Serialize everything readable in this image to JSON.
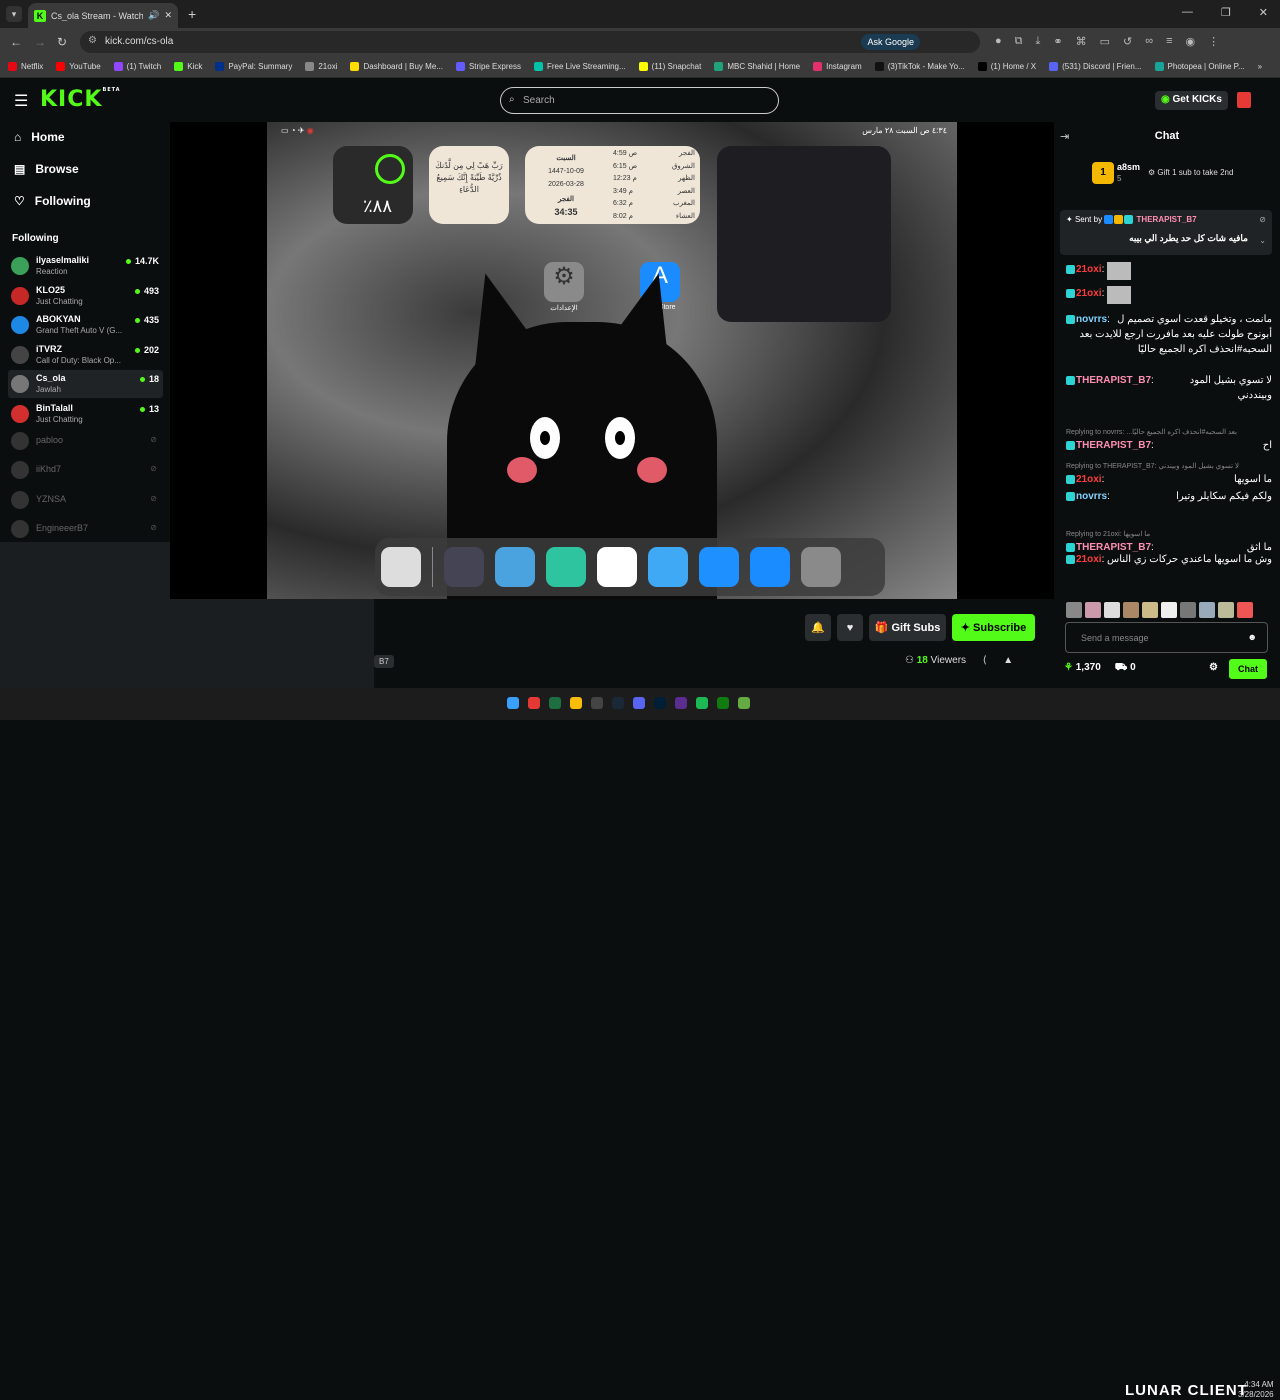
{
  "browser": {
    "tab_title": "Cs_ola Stream - Watch Live",
    "new_tab": "+",
    "url": "kick.com/cs-ola",
    "ask_google": "Ask Google",
    "bookmarks": [
      {
        "label": "Netflix",
        "color": "#e50914"
      },
      {
        "label": "YouTube",
        "color": "#ff0000"
      },
      {
        "label": "(1) Twitch",
        "color": "#9146ff"
      },
      {
        "label": "Kick",
        "color": "#53fc18"
      },
      {
        "label": "PayPal: Summary",
        "color": "#003087"
      },
      {
        "label": "21oxi",
        "color": "#888888"
      },
      {
        "label": "Dashboard | Buy Me...",
        "color": "#ffdd00"
      },
      {
        "label": "Stripe Express",
        "color": "#635bff"
      },
      {
        "label": "Free Live Streaming...",
        "color": "#00c2a8"
      },
      {
        "label": "(11) Snapchat",
        "color": "#fffc00"
      },
      {
        "label": "MBC Shahid | Home",
        "color": "#1fa37a"
      },
      {
        "label": "Instagram",
        "color": "#e1306c"
      },
      {
        "label": "(3)TikTok - Make Yo...",
        "color": "#111111"
      },
      {
        "label": "(1) Home / X",
        "color": "#000000"
      },
      {
        "label": "(531) Discord | Frien...",
        "color": "#5865f2"
      },
      {
        "label": "Photopea | Online P...",
        "color": "#18a497"
      }
    ]
  },
  "kick": {
    "logo": "KICK",
    "logo_beta": "BETA",
    "search_placeholder": "Search",
    "get_kicks": "Get KICKs"
  },
  "sidebar": {
    "nav": [
      {
        "label": "Home",
        "icon": "home-icon"
      },
      {
        "label": "Browse",
        "icon": "browse-icon"
      },
      {
        "label": "Following",
        "icon": "heart-icon"
      }
    ],
    "following_header": "Following",
    "channels": [
      {
        "name": "ilyaselmaliki",
        "game": "Reaction",
        "viewers": "14.7K",
        "color": "#3aa05a"
      },
      {
        "name": "KLO25",
        "game": "Just Chatting",
        "viewers": "493",
        "color": "#c62828"
      },
      {
        "name": "ABOKYAN",
        "game": "Grand Theft Auto V (G...",
        "viewers": "435",
        "color": "#1e88e5"
      },
      {
        "name": "iTVRZ",
        "game": "Call of Duty: Black Op...",
        "viewers": "202",
        "color": "#444444"
      },
      {
        "name": "Cs_ola",
        "game": "Jawlah",
        "viewers": "18",
        "color": "#777777"
      },
      {
        "name": "BinTalall",
        "game": "Just Chatting",
        "viewers": "13",
        "color": "#d32f2f"
      }
    ],
    "offline": [
      "pabloo",
      "iiKhd7",
      "YZNSA",
      "EngineeerB7"
    ]
  },
  "stream": {
    "ipad": {
      "battery_widget": "٪٨٨",
      "dua_text": "رَبِّ هَبْ لِي مِن لَّدُنكَ ذُرِّيَّةً طَيِّبَةً إِنَّكَ سَمِيعُ الدُّعَاءِ",
      "day": "السبت",
      "hijri": "1447-10-09",
      "greg": "2026-03-28",
      "prayer_next": "الفجر",
      "countdown": "34:35",
      "prayers": [
        {
          "name": "الفجر",
          "time": "4:59 ص"
        },
        {
          "name": "الشروق",
          "time": "6:15 ص"
        },
        {
          "name": "الظهر",
          "time": "12:23 م"
        },
        {
          "name": "العصر",
          "time": "3:49 م"
        },
        {
          "name": "المغرب",
          "time": "6:32 م"
        },
        {
          "name": "العشاء",
          "time": "8:02 م"
        }
      ],
      "status_time": "٤:٣٤ ص السبت ٢٨ مارس",
      "settings_label": "الإعدادات",
      "appstore_label": "App Store"
    },
    "gift_subs": "Gift Subs",
    "subscribe": "Subscribe",
    "viewers_count": "18",
    "viewers_label": "Viewers",
    "tag": "B7"
  },
  "chat": {
    "title": "Chat",
    "leader_name": "a8sm",
    "leader_count": "5",
    "leader_rank": "1",
    "gift_prompt": "Gift 1 sub to take 2nd",
    "pinned": {
      "sent_by": "Sent by",
      "user": "THERAPIST_B7",
      "text": "مافيه شات كل حد يطرد الي بيبه"
    },
    "messages": [
      {
        "user": "21oxi",
        "color": "#ff3b3b",
        "text": "",
        "reply": ""
      },
      {
        "user": "21oxi",
        "color": "#ff3b3b",
        "text": "",
        "reply": ""
      },
      {
        "user": "novrrs",
        "color": "#7fd3ff",
        "text": "مانمت ، وتخيلو قعدت اسوي تصميم ل أبونوح طولت عليه بعد مافررت ارجع للايدت بعد السحبه#انحذف اكره الجميع حاليًا",
        "reply": ""
      },
      {
        "user": "THERAPIST_B7",
        "color": "#ff8fb1",
        "text": "لا تسوي بشيل المود وبينددني",
        "reply": ""
      },
      {
        "user": "THERAPIST_B7",
        "color": "#ff8fb1",
        "text": "اح",
        "reply": "Replying to novrrs: ...بعد السحبه#انحذف اكره الجميع حاليًا"
      },
      {
        "user": "21oxi",
        "color": "#ff3b3b",
        "text": "ما اسويها",
        "reply": "Replying to THERAPIST_B7: لا تسوي بشيل المود وبيندني"
      },
      {
        "user": "novrrs",
        "color": "#7fd3ff",
        "text": "ولكم فيكم سكايلر وتيرا",
        "reply": ""
      },
      {
        "user": "THERAPIST_B7",
        "color": "#ff8fb1",
        "text": "ما اثق",
        "reply": "Replying to 21oxi: ما اسويها"
      },
      {
        "user": "21oxi",
        "color": "#ff3b3b",
        "text": "وش ما اسويها ماعندي حركات زي الناس",
        "reply": ""
      }
    ],
    "input_placeholder": "Send a message",
    "points": "1,370",
    "count": "0",
    "chat_button": "Chat"
  },
  "taskbar": {
    "brand": "LUNAR CLIENT",
    "time": "4:34 AM",
    "date": "3/28/2026"
  }
}
